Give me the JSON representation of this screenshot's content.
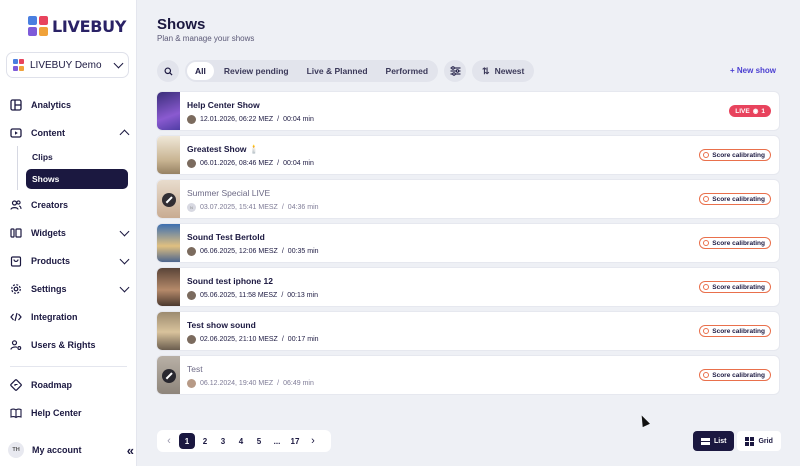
{
  "app": {
    "logo_text": "LIVEBUY",
    "workspace": "LIVEBUY Demo"
  },
  "colors": {
    "primary": "#1b1840",
    "accent": "#4b3fd1",
    "live": "#e8435d",
    "calibrating": "#e9704c",
    "logo": [
      "#4a7fe0",
      "#e8435d",
      "#7e5bd9",
      "#f0a23a"
    ]
  },
  "sidebar": {
    "items": [
      {
        "label": "Analytics",
        "icon": "layout-icon"
      },
      {
        "label": "Content",
        "icon": "play-icon"
      },
      {
        "label": "Clips"
      },
      {
        "label": "Shows"
      },
      {
        "label": "Creators",
        "icon": "users-icon"
      },
      {
        "label": "Widgets",
        "icon": "widgets-icon"
      },
      {
        "label": "Products",
        "icon": "bag-icon"
      },
      {
        "label": "Settings",
        "icon": "gear-icon"
      },
      {
        "label": "Integration",
        "icon": "code-icon"
      },
      {
        "label": "Users & Rights",
        "icon": "user-key-icon"
      },
      {
        "label": "Roadmap",
        "icon": "roadmap-icon"
      },
      {
        "label": "Help Center",
        "icon": "book-icon"
      }
    ],
    "account": {
      "initials": "TH",
      "label": "My account",
      "collapse": "«"
    }
  },
  "header": {
    "title": "Shows",
    "subtitle": "Plan & manage your shows"
  },
  "filters": {
    "tabs": [
      "All",
      "Review pending",
      "Live & Planned",
      "Performed"
    ],
    "sort": "Newest",
    "new_show": "+ New show"
  },
  "shows": [
    {
      "title": "Help Center Show",
      "date": "12.01.2026, 06:22 MEZ",
      "sep": "/",
      "duration": "00:04 min",
      "status": "LIVE",
      "viewers": "1",
      "thumb": "#6a4ab5"
    },
    {
      "title": "Greatest Show 🕯️",
      "date": "06.01.2026, 08:46 MEZ",
      "sep": "/",
      "duration": "00:04 min",
      "status": "Score calibrating",
      "thumb": "#d9c8a8"
    },
    {
      "title": "Summer Special LIVE",
      "date": "03.07.2025, 15:41 MESZ",
      "sep": "/",
      "duration": "04:36 min",
      "status": "Score calibrating",
      "thumb": "#c9b7a8",
      "hidden": true,
      "avatar_text": "N"
    },
    {
      "title": "Sound Test Bertold",
      "date": "06.06.2025, 12:06 MESZ",
      "sep": "/",
      "duration": "00:35 min",
      "status": "Score calibrating",
      "thumb": "#4a78b0"
    },
    {
      "title": "Sound test iphone 12",
      "date": "05.06.2025, 11:58 MESZ",
      "sep": "/",
      "duration": "00:13 min",
      "status": "Score calibrating",
      "thumb": "#6e5546"
    },
    {
      "title": "Test show sound",
      "date": "02.06.2025, 21:10 MESZ",
      "sep": "/",
      "duration": "00:17 min",
      "status": "Score calibrating",
      "thumb": "#8a7a62"
    },
    {
      "title": "Test",
      "date": "06.12.2024, 19:40 MEZ",
      "sep": "/",
      "duration": "06:49 min",
      "status": "Score calibrating",
      "thumb": "#9a928a",
      "hidden": true
    }
  ],
  "pagination": {
    "pages": [
      "1",
      "2",
      "3",
      "4",
      "5",
      "...",
      "17"
    ],
    "current": "1",
    "prev": "‹",
    "next": "›"
  },
  "view": {
    "list": "List",
    "grid": "Grid",
    "active": "List"
  }
}
